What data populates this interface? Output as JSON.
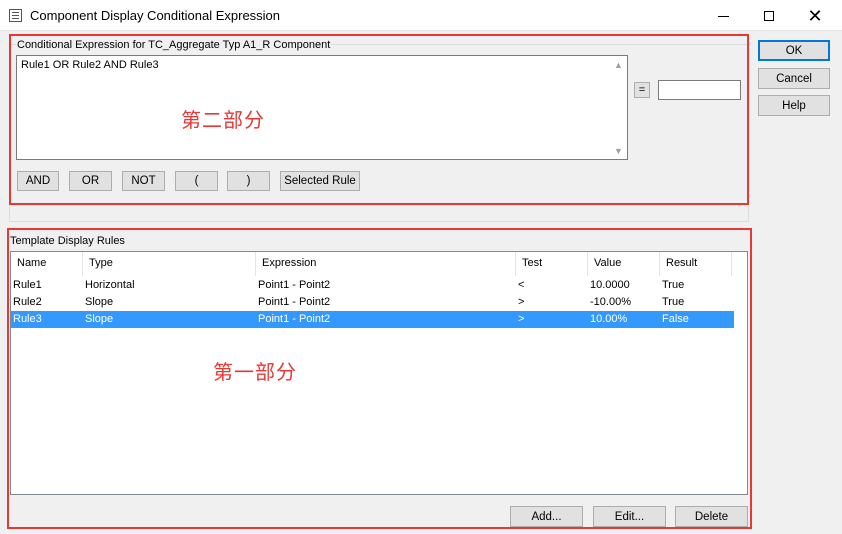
{
  "window": {
    "title": "Component Display Conditional Expression",
    "controls": {
      "minimize_icon": "minimize-icon",
      "maximize_icon": "maximize-icon",
      "close_icon": "close-icon",
      "close_glyph": "✕"
    }
  },
  "dialog_buttons": {
    "ok": "OK",
    "cancel": "Cancel",
    "help": "Help"
  },
  "expression_group": {
    "label": "Conditional Expression for TC_Aggregate Typ A1_R Component",
    "expression_text": "Rule1 OR Rule2 AND Rule3",
    "equals_label": "=",
    "result_value": "",
    "operator_buttons": [
      "AND",
      "OR",
      "NOT",
      "(",
      ")",
      "Selected Rule"
    ]
  },
  "annotations": {
    "section_two": "第二部分",
    "section_one": "第一部分"
  },
  "rules_group": {
    "label": "Template Display Rules",
    "columns": [
      "Name",
      "Type",
      "Expression",
      "Test",
      "Value",
      "Result"
    ],
    "rows": [
      {
        "name": "Rule1",
        "type": "Horizontal",
        "expression": "Point1 - Point2",
        "test": "<",
        "value": "10.0000",
        "result": "True"
      },
      {
        "name": "Rule2",
        "type": "Slope",
        "expression": "Point1 - Point2",
        "test": ">",
        "value": "-10.00%",
        "result": "True"
      },
      {
        "name": "Rule3",
        "type": "Slope",
        "expression": "Point1 - Point2",
        "test": ">",
        "value": "10.00%",
        "result": "False"
      }
    ],
    "selected_row": "Rule3"
  },
  "list_buttons": {
    "add": "Add...",
    "edit": "Edit...",
    "delete": "Delete"
  },
  "colors": {
    "highlight_border": "#e53935",
    "selection": "#3399ff",
    "default_button_border": "#0078d7"
  }
}
